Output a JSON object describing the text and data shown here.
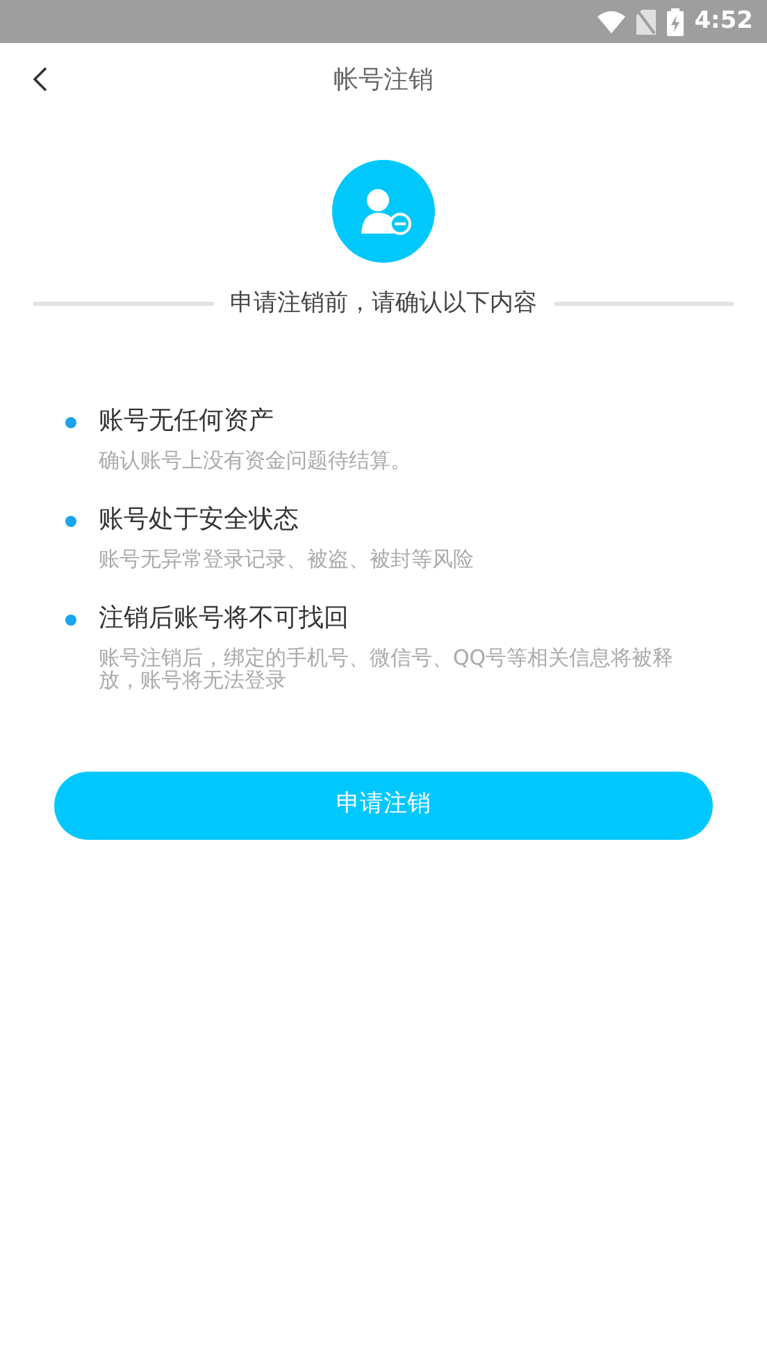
{
  "status_bar": {
    "time": "4:52"
  },
  "header": {
    "title": "帐号注销"
  },
  "intro": "申请注销前，请确认以下内容",
  "items": [
    {
      "title": "账号无任何资产",
      "desc": "确认账号上没有资金问题待结算。"
    },
    {
      "title": "账号处于安全状态",
      "desc": "账号无异常登录记录、被盗、被封等风险"
    },
    {
      "title": "注销后账号将不可找回",
      "desc": "账号注销后，绑定的手机号、微信号、QQ号等相关信息将被释放，账号将无法登录"
    }
  ],
  "button": "申请注销"
}
